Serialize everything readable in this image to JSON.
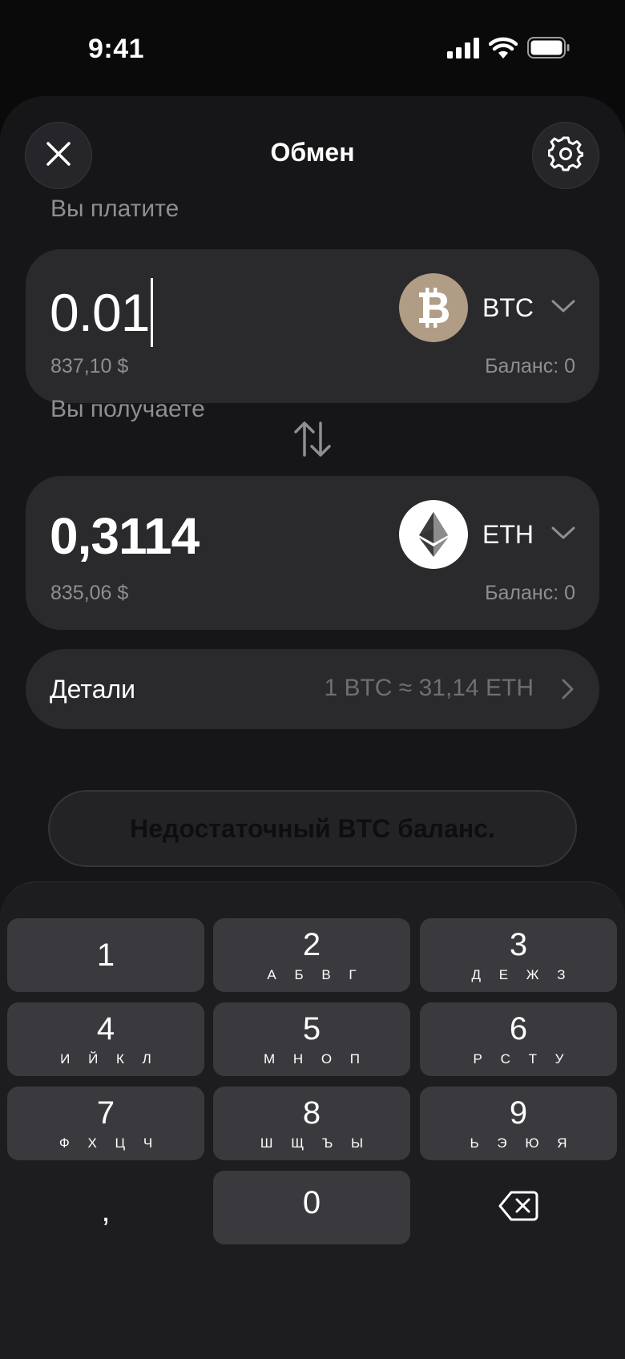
{
  "status_bar": {
    "time": "9:41"
  },
  "header": {
    "title": "Обмен",
    "close_icon": "close-icon",
    "settings_icon": "gear-icon"
  },
  "pay": {
    "label": "Вы платите",
    "amount": "0.01",
    "fiat": "837,10 $",
    "token": "BTC",
    "balance": "Баланс: 0",
    "token_color": "#b19c85"
  },
  "receive": {
    "label": "Вы получаете",
    "amount": "0,3114",
    "fiat": "835,06 $",
    "token": "ETH",
    "balance": "Баланс: 0"
  },
  "details": {
    "label": "Детали",
    "rate": "1 BTC ≈ 31,14 ETH"
  },
  "action": {
    "label": "Недостаточный BTC баланс."
  },
  "keypad": {
    "keys": [
      {
        "digit": "1",
        "letters": ""
      },
      {
        "digit": "2",
        "letters": "А Б В Г"
      },
      {
        "digit": "3",
        "letters": "Д Е Ж З"
      },
      {
        "digit": "4",
        "letters": "И Й К Л"
      },
      {
        "digit": "5",
        "letters": "М Н О П"
      },
      {
        "digit": "6",
        "letters": "Р С Т У"
      },
      {
        "digit": "7",
        "letters": "Ф Х Ц Ч"
      },
      {
        "digit": "8",
        "letters": "Ш Щ Ъ Ы"
      },
      {
        "digit": "9",
        "letters": "Ь Э Ю Я"
      },
      {
        "digit": "0",
        "letters": ""
      }
    ],
    "decimal": ",",
    "backspace_icon": "backspace-icon"
  }
}
